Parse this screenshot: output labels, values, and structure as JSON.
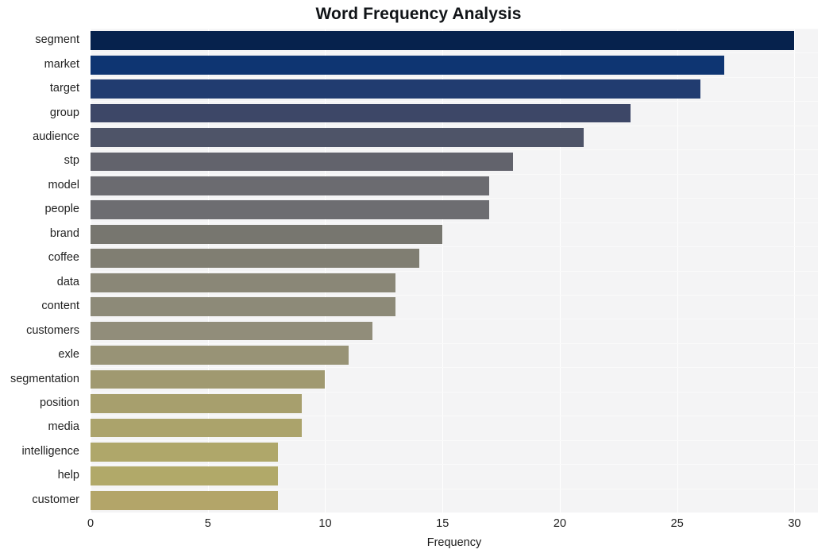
{
  "chart_data": {
    "type": "bar",
    "orientation": "horizontal",
    "title": "Word Frequency Analysis",
    "xlabel": "Frequency",
    "ylabel": "",
    "xlim": [
      0,
      31
    ],
    "xticks": [
      0,
      5,
      10,
      15,
      20,
      25,
      30
    ],
    "xtick_labels": [
      "0",
      "5",
      "10",
      "15",
      "20",
      "25",
      "30"
    ],
    "grid": true,
    "grid_axis": "both",
    "legend": false,
    "plot_background": "#f4f4f5",
    "grid_color": "#ffffff",
    "figure_background": "#ffffff",
    "categories": [
      "segment",
      "market",
      "target",
      "group",
      "audience",
      "stp",
      "model",
      "people",
      "brand",
      "coffee",
      "data",
      "content",
      "customers",
      "exle",
      "segmentation",
      "position",
      "media",
      "intelligence",
      "help",
      "customer"
    ],
    "values": [
      30,
      27,
      26,
      23,
      21,
      18,
      17,
      17,
      15,
      14,
      13,
      13,
      12,
      11,
      10,
      9,
      9,
      8,
      8,
      8
    ],
    "bar_colors": [
      "#06224d",
      "#0e3572",
      "#213c70",
      "#3d4767",
      "#4e5468",
      "#62636c",
      "#6b6b70",
      "#6d6d71",
      "#77766f",
      "#807e72",
      "#8a8777",
      "#8d8a78",
      "#918d7a",
      "#989376",
      "#a09970",
      "#a79f6d",
      "#aba36b",
      "#afa76a",
      "#b1a969",
      "#b3a569"
    ]
  }
}
